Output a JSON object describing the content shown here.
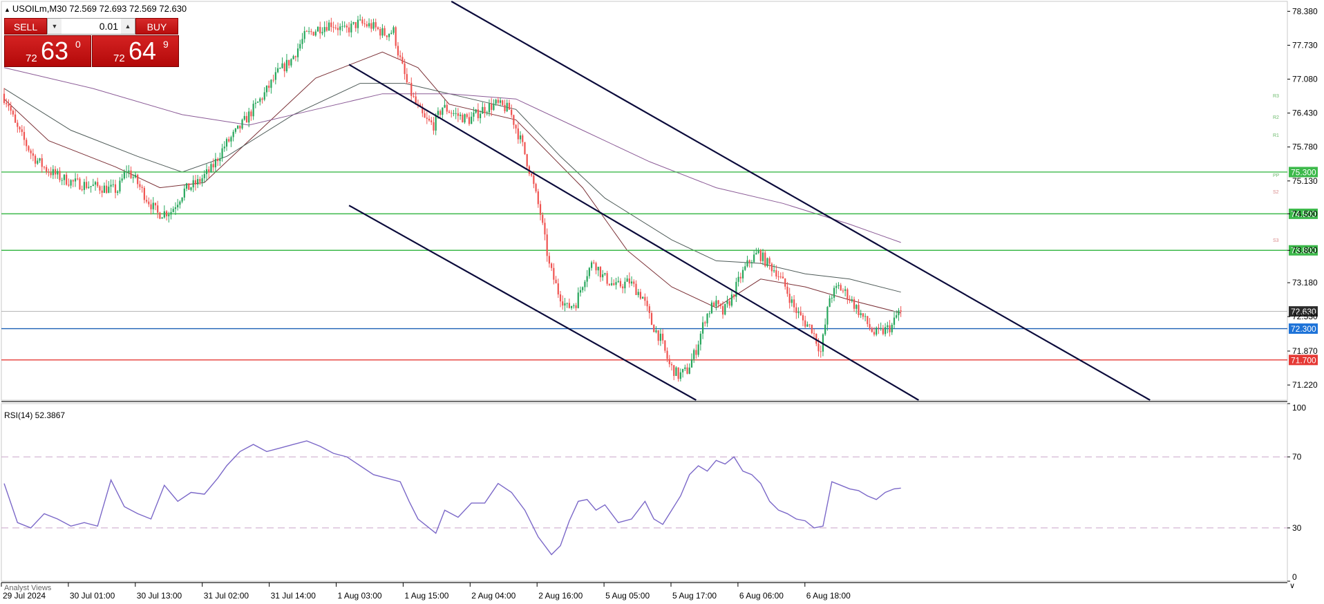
{
  "header": {
    "symbol_line": "USOILm,M30  72.569 72.693 72.569 72.630"
  },
  "trade_panel": {
    "sell_label": "SELL",
    "buy_label": "BUY",
    "lot_value": "0.01",
    "sell_price": {
      "prefix": "72",
      "big": "63",
      "sup": "0"
    },
    "buy_price": {
      "prefix": "72",
      "big": "64",
      "sup": "9"
    }
  },
  "colors": {
    "bull": "#26a65b",
    "bear": "#ef5350",
    "resistance": "#3cb94a",
    "support_blue": "#1a5fb4",
    "support_red": "#e53935",
    "channel": "#0b0b3b",
    "rsi": "#7b68c8"
  },
  "chart_data": [
    {
      "type": "candlestick",
      "symbol": "USOILm",
      "timeframe": "M30",
      "ylim": [
        70.93,
        78.57
      ],
      "y_ticks": [
        78.38,
        77.73,
        77.08,
        76.43,
        75.78,
        75.13,
        74.5,
        73.8,
        73.18,
        72.53,
        71.87,
        71.22
      ],
      "x_tick_labels": [
        "29 Jul 2024",
        "30 Jul 01:00",
        "30 Jul 13:00",
        "31 Jul 02:00",
        "31 Jul 14:00",
        "1 Aug 03:00",
        "1 Aug 15:00",
        "2 Aug 04:00",
        "2 Aug 16:00",
        "5 Aug 05:00",
        "5 Aug 17:00",
        "6 Aug 06:00",
        "6 Aug 18:00"
      ],
      "anchors": [
        [
          0,
          76.8
        ],
        [
          3,
          76.6
        ],
        [
          6,
          76.2
        ],
        [
          10,
          75.9
        ],
        [
          14,
          75.6
        ],
        [
          20,
          75.35
        ],
        [
          26,
          75.2
        ],
        [
          32,
          75.1
        ],
        [
          38,
          75.05
        ],
        [
          45,
          75.0
        ],
        [
          52,
          74.95
        ],
        [
          56,
          75.35
        ],
        [
          60,
          75.15
        ],
        [
          65,
          74.8
        ],
        [
          70,
          74.5
        ],
        [
          76,
          74.55
        ],
        [
          82,
          74.95
        ],
        [
          88,
          75.1
        ],
        [
          94,
          75.35
        ],
        [
          100,
          75.8
        ],
        [
          106,
          76.1
        ],
        [
          112,
          76.45
        ],
        [
          118,
          76.8
        ],
        [
          124,
          77.2
        ],
        [
          130,
          77.45
        ],
        [
          136,
          77.9
        ],
        [
          142,
          78.05
        ],
        [
          148,
          78.15
        ],
        [
          154,
          78.0
        ],
        [
          160,
          78.15
        ],
        [
          166,
          78.1
        ],
        [
          172,
          77.95
        ],
        [
          176,
          78.0
        ],
        [
          178,
          77.6
        ],
        [
          182,
          77.0
        ],
        [
          186,
          76.6
        ],
        [
          190,
          76.3
        ],
        [
          194,
          76.2
        ],
        [
          198,
          76.55
        ],
        [
          204,
          76.4
        ],
        [
          210,
          76.3
        ],
        [
          216,
          76.5
        ],
        [
          222,
          76.6
        ],
        [
          228,
          76.5
        ],
        [
          234,
          75.8
        ],
        [
          238,
          75.2
        ],
        [
          242,
          74.5
        ],
        [
          246,
          73.5
        ],
        [
          250,
          73.0
        ],
        [
          254,
          72.7
        ],
        [
          258,
          72.8
        ],
        [
          262,
          73.3
        ],
        [
          266,
          73.6
        ],
        [
          270,
          73.3
        ],
        [
          276,
          73.1
        ],
        [
          282,
          73.2
        ],
        [
          288,
          72.9
        ],
        [
          292,
          72.4
        ],
        [
          296,
          72.1
        ],
        [
          300,
          71.6
        ],
        [
          304,
          71.4
        ],
        [
          308,
          71.5
        ],
        [
          312,
          71.9
        ],
        [
          316,
          72.5
        ],
        [
          320,
          72.8
        ],
        [
          324,
          72.6
        ],
        [
          328,
          72.9
        ],
        [
          332,
          73.3
        ],
        [
          336,
          73.6
        ],
        [
          340,
          73.75
        ],
        [
          344,
          73.55
        ],
        [
          348,
          73.4
        ],
        [
          352,
          73.1
        ],
        [
          356,
          72.7
        ],
        [
          360,
          72.45
        ],
        [
          364,
          72.3
        ],
        [
          368,
          71.85
        ],
        [
          372,
          72.9
        ],
        [
          376,
          73.1
        ],
        [
          380,
          72.95
        ],
        [
          384,
          72.7
        ],
        [
          388,
          72.45
        ],
        [
          392,
          72.2
        ],
        [
          396,
          72.25
        ],
        [
          400,
          72.35
        ],
        [
          403,
          72.63
        ]
      ],
      "last_close": 72.63,
      "horizontal_levels": [
        {
          "label": "75.300",
          "value": 75.3,
          "role": "resistance"
        },
        {
          "label": "74.500",
          "value": 74.5,
          "role": "resistance"
        },
        {
          "label": "73.800",
          "value": 73.8,
          "role": "resistance"
        },
        {
          "label": "72.630",
          "value": 72.63,
          "role": "current"
        },
        {
          "label": "72.300",
          "value": 72.3,
          "role": "support_blue"
        },
        {
          "label": "71.700",
          "value": 71.7,
          "role": "support_red"
        }
      ],
      "pivot_marks": [
        "R3",
        "R2",
        "R1",
        "PP",
        "S2",
        "S3"
      ],
      "channels": [
        {
          "from": [
            201,
            78.57
          ],
          "to": [
            515,
            70.93
          ]
        },
        {
          "from": [
            155,
            77.36
          ],
          "to": [
            411,
            70.93
          ]
        },
        {
          "from": [
            155,
            74.66
          ],
          "to": [
            311,
            70.93
          ]
        }
      ],
      "moving_averages": [
        {
          "period_hint": "fast",
          "values": [
            [
              0,
              76.7
            ],
            [
              20,
              75.9
            ],
            [
              50,
              75.4
            ],
            [
              70,
              75.0
            ],
            [
              90,
              75.1
            ],
            [
              110,
              75.9
            ],
            [
              140,
              77.1
            ],
            [
              170,
              77.6
            ],
            [
              186,
              77.3
            ],
            [
              200,
              76.6
            ],
            [
              230,
              76.3
            ],
            [
              260,
              75.0
            ],
            [
              280,
              73.8
            ],
            [
              300,
              73.1
            ],
            [
              320,
              72.7
            ],
            [
              340,
              73.25
            ],
            [
              360,
              73.1
            ],
            [
              380,
              72.85
            ],
            [
              403,
              72.6
            ]
          ]
        },
        {
          "period_hint": "medium",
          "values": [
            [
              0,
              76.9
            ],
            [
              30,
              76.1
            ],
            [
              60,
              75.6
            ],
            [
              80,
              75.3
            ],
            [
              100,
              75.6
            ],
            [
              130,
              76.4
            ],
            [
              160,
              77.0
            ],
            [
              180,
              77.0
            ],
            [
              200,
              76.8
            ],
            [
              230,
              76.5
            ],
            [
              250,
              75.6
            ],
            [
              270,
              74.8
            ],
            [
              300,
              74.0
            ],
            [
              320,
              73.6
            ],
            [
              340,
              73.55
            ],
            [
              360,
              73.35
            ],
            [
              380,
              73.25
            ],
            [
              403,
              73.0
            ]
          ]
        },
        {
          "period_hint": "slow",
          "values": [
            [
              0,
              77.3
            ],
            [
              40,
              76.9
            ],
            [
              80,
              76.4
            ],
            [
              110,
              76.2
            ],
            [
              140,
              76.5
            ],
            [
              170,
              76.8
            ],
            [
              200,
              76.8
            ],
            [
              230,
              76.7
            ],
            [
              260,
              76.1
            ],
            [
              290,
              75.5
            ],
            [
              320,
              75.0
            ],
            [
              350,
              74.7
            ],
            [
              380,
              74.3
            ],
            [
              403,
              73.95
            ]
          ]
        }
      ]
    },
    {
      "type": "line",
      "title": "RSI(14) 52.3867",
      "ylim": [
        0,
        100
      ],
      "y_ticks": [
        100,
        70,
        30,
        0
      ],
      "levels": [
        70,
        30
      ],
      "series": [
        {
          "name": "RSI(14)",
          "values": [
            [
              0,
              55
            ],
            [
              6,
              33
            ],
            [
              12,
              30
            ],
            [
              18,
              38
            ],
            [
              24,
              35
            ],
            [
              30,
              31
            ],
            [
              36,
              33
            ],
            [
              42,
              31
            ],
            [
              48,
              57
            ],
            [
              54,
              42
            ],
            [
              60,
              38
            ],
            [
              66,
              35
            ],
            [
              72,
              54
            ],
            [
              78,
              45
            ],
            [
              84,
              50
            ],
            [
              90,
              49
            ],
            [
              96,
              58
            ],
            [
              100,
              65
            ],
            [
              106,
              73
            ],
            [
              112,
              77
            ],
            [
              118,
              73
            ],
            [
              124,
              75
            ],
            [
              130,
              77
            ],
            [
              136,
              79
            ],
            [
              142,
              76
            ],
            [
              148,
              72
            ],
            [
              154,
              70
            ],
            [
              160,
              65
            ],
            [
              166,
              60
            ],
            [
              172,
              58
            ],
            [
              178,
              56
            ],
            [
              182,
              45
            ],
            [
              186,
              35
            ],
            [
              190,
              31
            ],
            [
              194,
              27
            ],
            [
              198,
              40
            ],
            [
              204,
              36
            ],
            [
              210,
              44
            ],
            [
              216,
              44
            ],
            [
              222,
              55
            ],
            [
              228,
              50
            ],
            [
              234,
              40
            ],
            [
              240,
              25
            ],
            [
              246,
              15
            ],
            [
              250,
              20
            ],
            [
              254,
              34
            ],
            [
              258,
              45
            ],
            [
              262,
              46
            ],
            [
              266,
              40
            ],
            [
              270,
              43
            ],
            [
              276,
              33
            ],
            [
              282,
              35
            ],
            [
              288,
              45
            ],
            [
              292,
              35
            ],
            [
              296,
              32
            ],
            [
              300,
              40
            ],
            [
              304,
              48
            ],
            [
              308,
              60
            ],
            [
              312,
              65
            ],
            [
              316,
              62
            ],
            [
              320,
              68
            ],
            [
              324,
              66
            ],
            [
              328,
              70
            ],
            [
              332,
              62
            ],
            [
              336,
              60
            ],
            [
              340,
              55
            ],
            [
              344,
              45
            ],
            [
              348,
              40
            ],
            [
              352,
              38
            ],
            [
              356,
              35
            ],
            [
              360,
              34
            ],
            [
              364,
              30
            ],
            [
              368,
              31
            ],
            [
              372,
              56
            ],
            [
              376,
              54
            ],
            [
              380,
              52
            ],
            [
              384,
              51
            ],
            [
              388,
              48
            ],
            [
              392,
              46
            ],
            [
              396,
              50
            ],
            [
              400,
              52
            ],
            [
              403,
              52.4
            ]
          ]
        }
      ]
    }
  ],
  "bottom_tab": "Analyst Views"
}
